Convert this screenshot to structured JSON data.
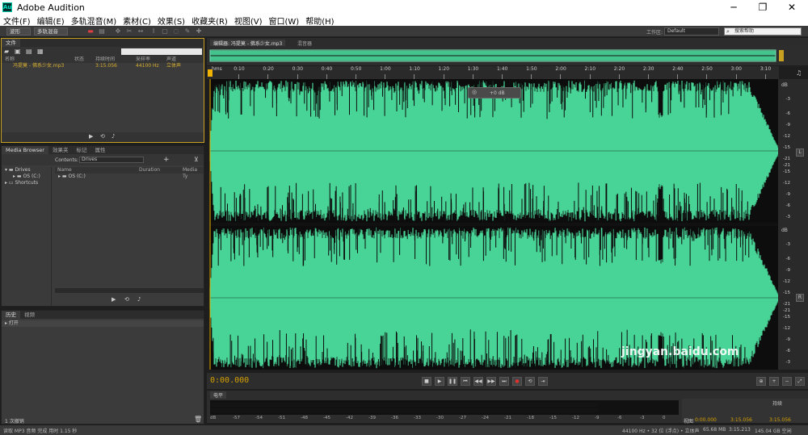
{
  "window": {
    "title": "Adobe Audition",
    "logo_text": "Au",
    "minimize": "─",
    "maximize": "❐",
    "close": "✕"
  },
  "menu": [
    "文件(F)",
    "编辑(E)",
    "多轨混音(M)",
    "素材(C)",
    "效果(S)",
    "收藏夹(R)",
    "视图(V)",
    "窗口(W)",
    "帮助(H)"
  ],
  "toolbar": {
    "waveform_btn": "波形",
    "multitrack_btn": "多轨混音",
    "workspace_label": "工作区:",
    "workspace_value": "Default",
    "search_placeholder": "搜索帮助"
  },
  "files_panel": {
    "tab": "文件",
    "columns": [
      "名称",
      "状态",
      "持续时间",
      "采样率",
      "声道"
    ],
    "rows": [
      {
        "name": "冯提莫 - 佛系少女.mp3",
        "duration": "3:15.056",
        "sample_rate": "44100 Hz",
        "channels": "立体声"
      }
    ]
  },
  "media_panel": {
    "tabs": [
      "Media Browser",
      "效果夹",
      "标记",
      "属性"
    ],
    "contents_label": "Contents:",
    "contents_value": "Drives",
    "tree": [
      "Drives",
      "OS (C:)",
      "Shortcuts"
    ],
    "columns": [
      "Name",
      "Duration",
      "Media Ty"
    ],
    "list": [
      "OS (C:)"
    ]
  },
  "history_panel": {
    "tabs": [
      "历史",
      "视频"
    ],
    "items": [
      "打开"
    ],
    "footer": "1 次撤销"
  },
  "editor": {
    "tab": "编辑器: 冯提莫 - 佛系少女.mp3",
    "tab2": "混音器",
    "ruler_unit": "hms",
    "ticks": [
      "0:10",
      "0:20",
      "0:30",
      "0:40",
      "0:50",
      "1:00",
      "1:10",
      "1:20",
      "1:30",
      "1:40",
      "1:50",
      "2:00",
      "2:10",
      "2:20",
      "2:30",
      "2:40",
      "2:50",
      "3:00",
      "3:10"
    ],
    "hud_value": "+0 dB",
    "db_unit": "dB",
    "db_labels": [
      "-3",
      "-6",
      "-9",
      "-12",
      "-15",
      "-21",
      "-21",
      "-15",
      "-12",
      "-9",
      "-6",
      "-3"
    ],
    "channel_l": "L",
    "channel_r": "R",
    "current_time": "0:00.000"
  },
  "levels_panel": {
    "tab": "电平",
    "scale": [
      "dB",
      "-57",
      "-54",
      "-51",
      "-48",
      "-45",
      "-42",
      "-39",
      "-36",
      "-33",
      "-30",
      "-27",
      "-24",
      "-21",
      "-18",
      "-15",
      "-12",
      "-9",
      "-6",
      "-3",
      "0"
    ]
  },
  "selection_panel": {
    "header": "持续",
    "view_label": "视图",
    "start": "0:00.000",
    "end": "3:15.056",
    "duration": "3:15.056"
  },
  "status": {
    "left": "读取 MP3 音频 完成 用时 1.15 秒",
    "format": "44100 Hz • 32 位 (浮点) • 立体声",
    "size": "65.68 MB",
    "length": "3:15.213",
    "free": "145.04 GB 空闲"
  },
  "watermark": "jingyan.baidu.com",
  "colors": {
    "waveform": "#48d496",
    "playhead": "#f0b400",
    "time_display": "#d4a000"
  }
}
